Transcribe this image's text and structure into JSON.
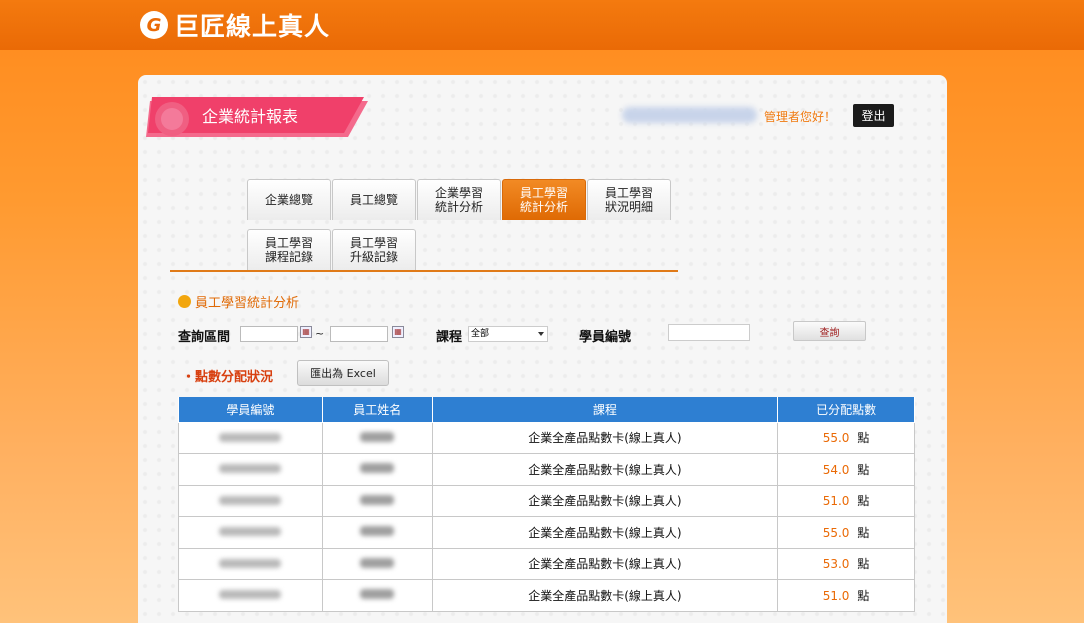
{
  "brand": {
    "logo_letter": "G",
    "name": "巨匠線上真人"
  },
  "page": {
    "title": "企業統計報表"
  },
  "header": {
    "greeting": "管理者您好！",
    "logout_label": "登出"
  },
  "tabs": [
    {
      "label": "企業總覽",
      "active": false
    },
    {
      "label": "員工總覽",
      "active": false
    },
    {
      "label": "企業學習\n統計分析",
      "active": false
    },
    {
      "label": "員工學習\n統計分析",
      "active": true
    },
    {
      "label": "員工學習\n狀況明細",
      "active": false
    },
    {
      "label": "員工學習\n課程記錄",
      "active": false
    },
    {
      "label": "員工學習\n升級記錄",
      "active": false
    }
  ],
  "section": {
    "title": "員工學習統計分析"
  },
  "query": {
    "period_label": "查詢區間",
    "tilde": "~",
    "course_label": "課程",
    "course_selected": "全部",
    "student_label": "學員編號",
    "search_button": "查詢"
  },
  "points": {
    "title": "・點數分配狀況",
    "export_label": "匯出為 Excel"
  },
  "table": {
    "headers": [
      "學員編號",
      "員工姓名",
      "課程",
      "已分配點數"
    ],
    "rows": [
      {
        "course": "企業全產品點數卡(線上真人)",
        "points": "55.0",
        "unit": "點"
      },
      {
        "course": "企業全產品點數卡(線上真人)",
        "points": "54.0",
        "unit": "點"
      },
      {
        "course": "企業全產品點數卡(線上真人)",
        "points": "51.0",
        "unit": "點"
      },
      {
        "course": "企業全產品點數卡(線上真人)",
        "points": "55.0",
        "unit": "點"
      },
      {
        "course": "企業全產品點數卡(線上真人)",
        "points": "53.0",
        "unit": "點"
      },
      {
        "course": "企業全產品點數卡(線上真人)",
        "points": "51.0",
        "unit": "點"
      }
    ]
  },
  "colors": {
    "accent": "#ea6a06",
    "header_blue": "#2e7fd2",
    "ribbon_pink": "#f0406a"
  }
}
